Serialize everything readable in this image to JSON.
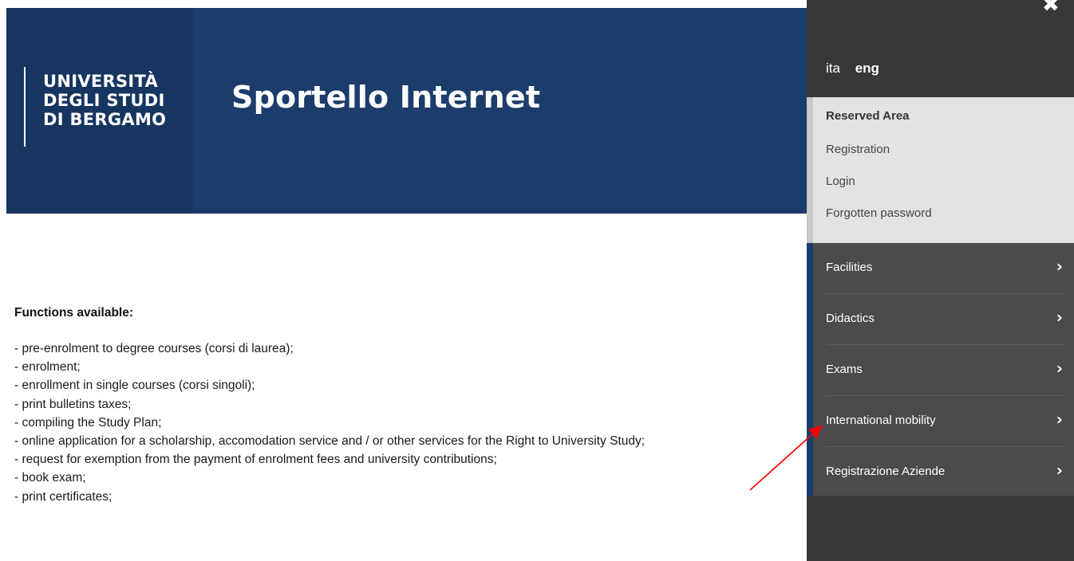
{
  "header": {
    "logo_lines": [
      "UNIVERSITÀ",
      "DEGLI STUDI",
      "DI BERGAMO"
    ],
    "title": "Sportello Internet"
  },
  "panel": {
    "close_symbol": "✖",
    "languages": {
      "ita": "ita",
      "eng": "eng"
    },
    "reserved": {
      "title": "Reserved Area",
      "links": [
        "Registration",
        "Login",
        "Forgotten password"
      ]
    },
    "menu": [
      {
        "label": "Facilities"
      },
      {
        "label": "Didactics"
      },
      {
        "label": "Exams"
      },
      {
        "label": "International mobility"
      },
      {
        "label": "Registrazione Aziende"
      }
    ],
    "chevron": "›"
  },
  "content": {
    "heading": "Functions available:",
    "items": [
      "- pre-enrolment to degree courses (corsi di laurea);",
      "- enrolment;",
      "- enrollment in single courses (corsi singoli);",
      "- print bulletins taxes;",
      "- compiling the Study Plan;",
      "- online application for a scholarship, accomodation service and / or other services for the Right to University Study;",
      "- request for exemption from the payment of enrolment fees and university contributions;",
      "- book exam;",
      "- print certificates;"
    ]
  },
  "annotation": {
    "arrow_color": "#ff0000"
  }
}
